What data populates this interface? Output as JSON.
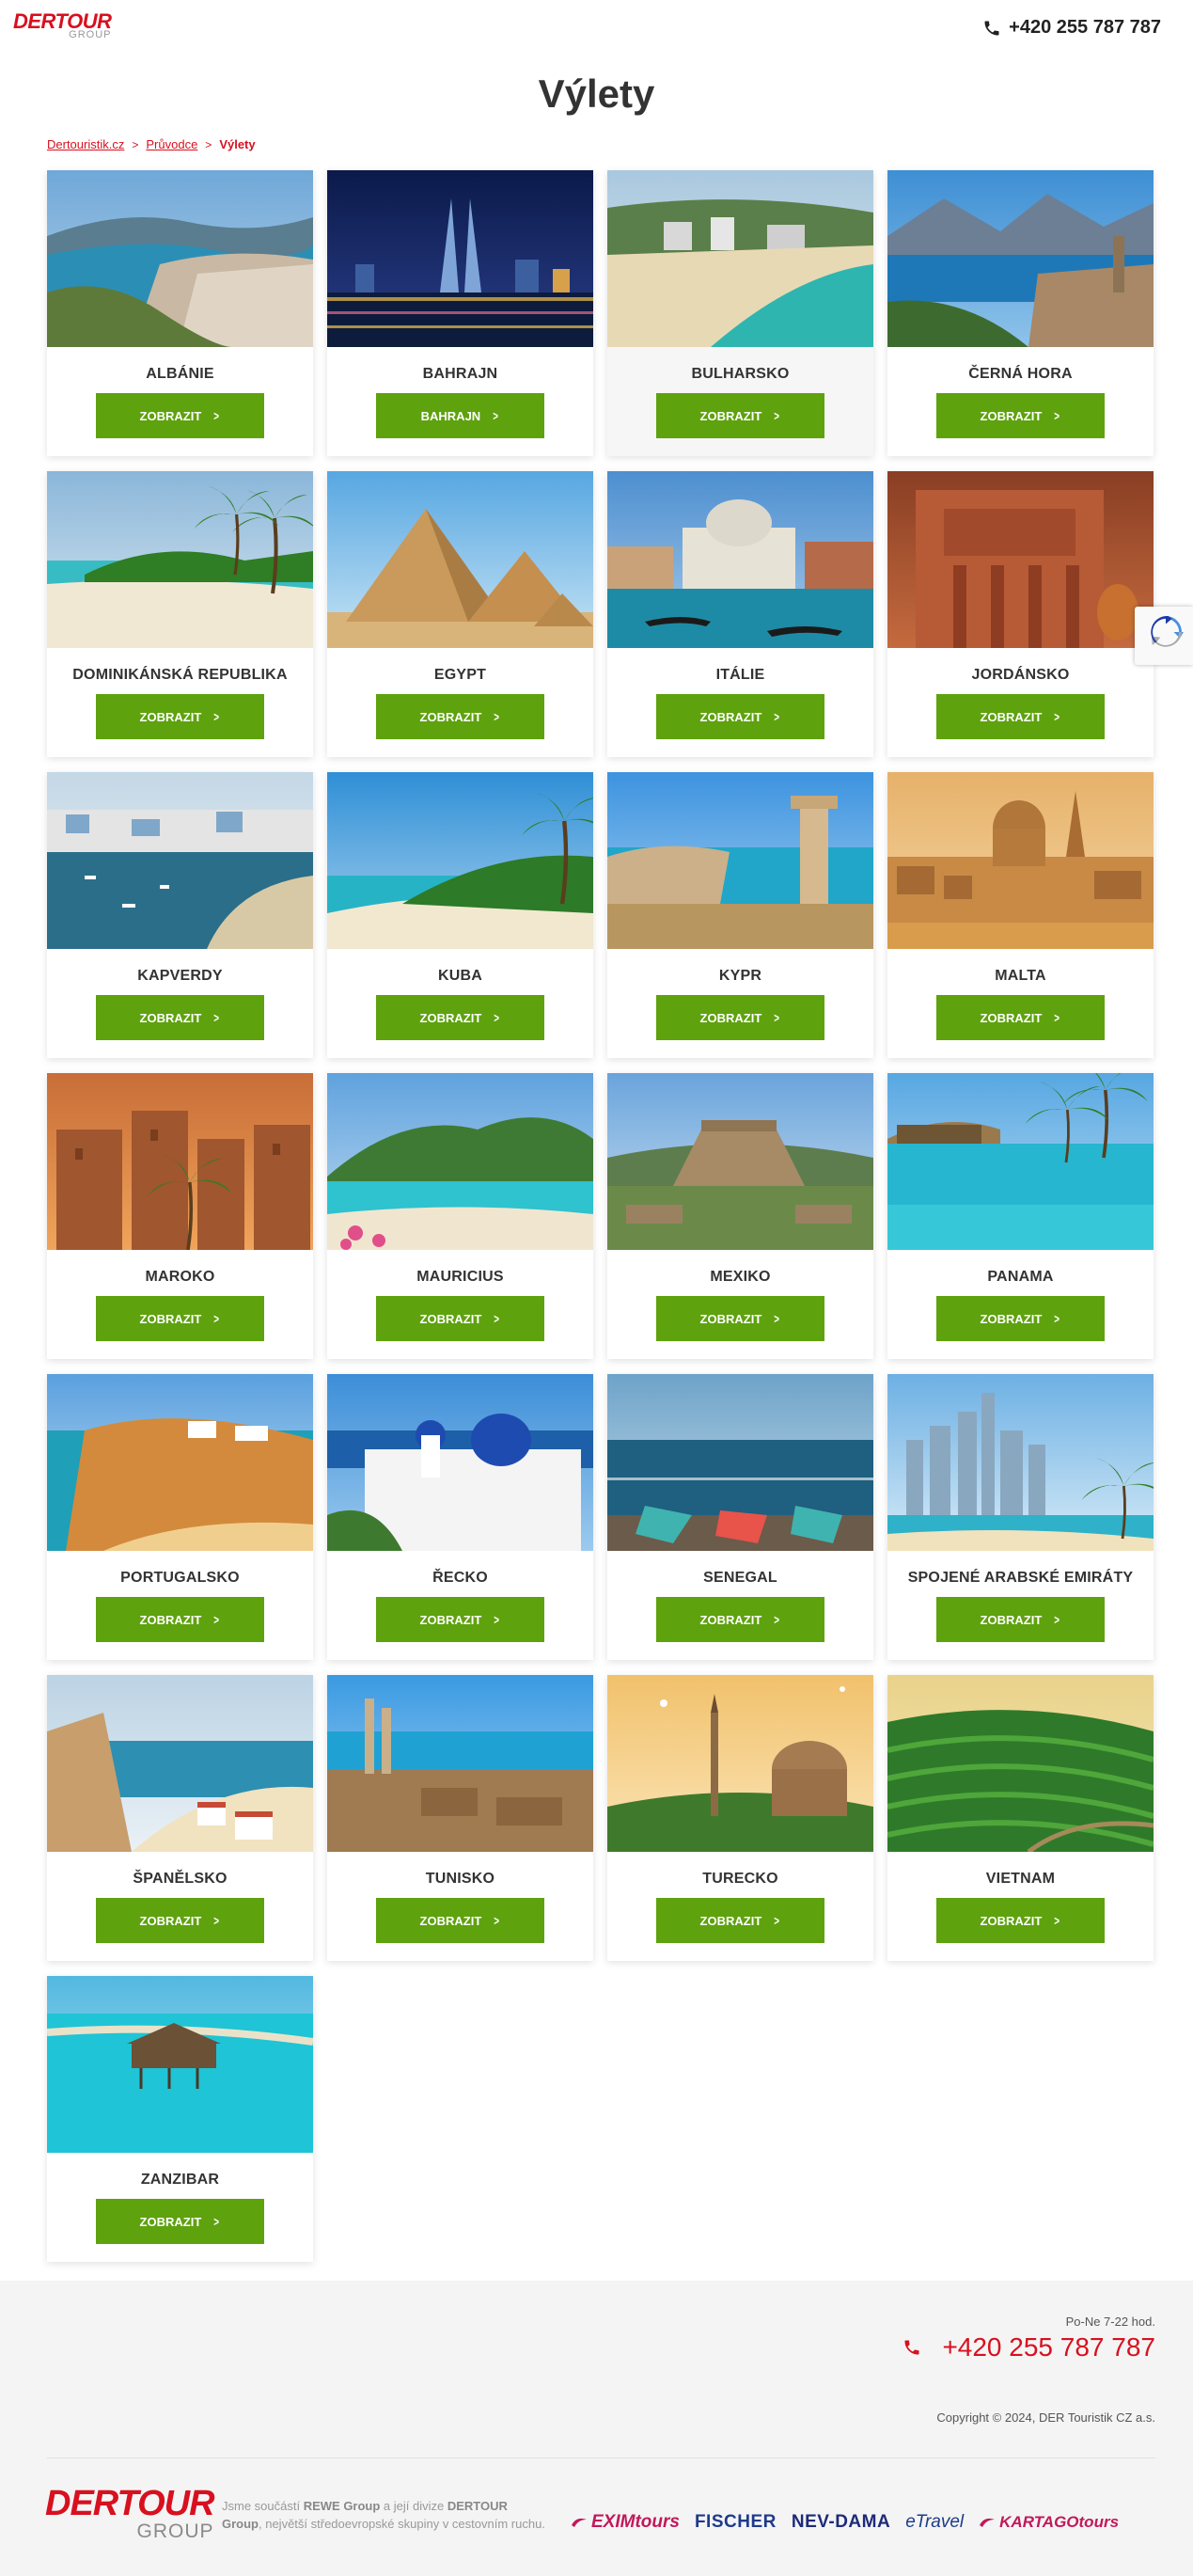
{
  "header": {
    "logo_main": "DERTOUR",
    "logo_sub": "GROUP",
    "phone": "+420 255 787 787"
  },
  "page": {
    "title": "Výlety"
  },
  "breadcrumb": {
    "items": [
      "Dertouristik.cz",
      "Průvodce"
    ],
    "current": "Výlety"
  },
  "destinations": [
    {
      "name": "ALBÁNIE",
      "button": "ZOBRAZIT",
      "scene": "coast-town"
    },
    {
      "name": "BAHRAJN",
      "button": "BAHRAJN",
      "scene": "night-skyline"
    },
    {
      "name": "BULHARSKO",
      "button": "ZOBRAZIT",
      "scene": "beach-resort"
    },
    {
      "name": "ČERNÁ HORA",
      "button": "ZOBRAZIT",
      "scene": "bay-mountains"
    },
    {
      "name": "DOMINIKÁNSKÁ REPUBLIKA",
      "button": "ZOBRAZIT",
      "scene": "palm-beach"
    },
    {
      "name": "EGYPT",
      "button": "ZOBRAZIT",
      "scene": "pyramids"
    },
    {
      "name": "ITÁLIE",
      "button": "ZOBRAZIT",
      "scene": "venice"
    },
    {
      "name": "JORDÁNSKO",
      "button": "ZOBRAZIT",
      "scene": "petra"
    },
    {
      "name": "KAPVERDY",
      "button": "ZOBRAZIT",
      "scene": "harbour-town"
    },
    {
      "name": "KUBA",
      "button": "ZOBRAZIT",
      "scene": "palm-beach-2"
    },
    {
      "name": "KYPR",
      "button": "ZOBRAZIT",
      "scene": "column-coast"
    },
    {
      "name": "MALTA",
      "button": "ZOBRAZIT",
      "scene": "dome-city"
    },
    {
      "name": "MAROKO",
      "button": "ZOBRAZIT",
      "scene": "kasbah"
    },
    {
      "name": "MAURICIUS",
      "button": "ZOBRAZIT",
      "scene": "lagoon-mountain"
    },
    {
      "name": "MEXIKO",
      "button": "ZOBRAZIT",
      "scene": "pyramid-ruin"
    },
    {
      "name": "PANAMA",
      "button": "ZOBRAZIT",
      "scene": "stilt-hut"
    },
    {
      "name": "PORTUGALSKO",
      "button": "ZOBRAZIT",
      "scene": "cliffs"
    },
    {
      "name": "ŘECKO",
      "button": "ZOBRAZIT",
      "scene": "santorini"
    },
    {
      "name": "SENEGAL",
      "button": "ZOBRAZIT",
      "scene": "boats"
    },
    {
      "name": "SPOJENÉ ARABSKÉ EMIRÁTY",
      "button": "ZOBRAZIT",
      "scene": "dubai"
    },
    {
      "name": "ŠPANĚLSKO",
      "button": "ZOBRAZIT",
      "scene": "old-town-bay"
    },
    {
      "name": "TUNISKO",
      "button": "ZOBRAZIT",
      "scene": "ruins-sea"
    },
    {
      "name": "TURECKO",
      "button": "ZOBRAZIT",
      "scene": "mosque"
    },
    {
      "name": "VIETNAM",
      "button": "ZOBRAZIT",
      "scene": "rice-terraces"
    },
    {
      "name": "ZANZIBAR",
      "button": "ZOBRAZIT",
      "scene": "turquoise-lagoon"
    }
  ],
  "footer": {
    "hours": "Po-Ne 7-22 hod.",
    "phone": "+420 255 787 787",
    "copyright": "Copyright © 2024, DER Touristik CZ a.s.",
    "logo_main": "DERTOUR",
    "logo_sub": "GROUP",
    "about_prefix": "Jsme součástí ",
    "about_rewe": "REWE Group",
    "about_mid": " a její divize ",
    "about_dertour": "DERTOUR Group",
    "about_suffix": ", největší středoevropské skupiny v cestovním ruchu.",
    "brands": [
      "EXIMtours",
      "FISCHER",
      "NEV-DAMA",
      "eTravel",
      "KARTAGOtours"
    ]
  },
  "colors": {
    "brand_red": "#d8101f",
    "button_green": "#5ea20e"
  }
}
